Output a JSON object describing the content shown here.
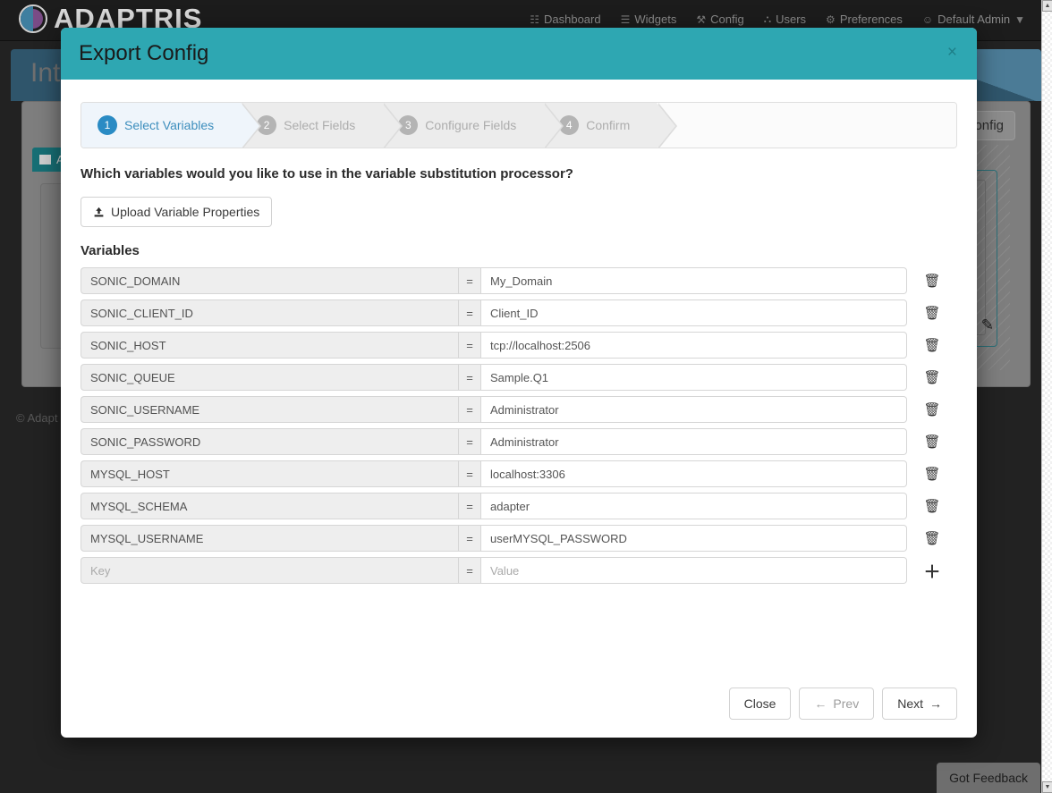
{
  "navbar": {
    "brand": "ADAPTRIS",
    "links": [
      {
        "label": "Dashboard",
        "icon": "dashboard-icon",
        "glyph": "☷"
      },
      {
        "label": "Widgets",
        "icon": "widgets-icon",
        "glyph": "☰"
      },
      {
        "label": "Config",
        "icon": "wrench-icon",
        "glyph": "⚒"
      },
      {
        "label": "Users",
        "icon": "users-icon",
        "glyph": "⛬"
      },
      {
        "label": "Preferences",
        "icon": "gears-icon",
        "glyph": "⚙"
      },
      {
        "label": "Default Admin",
        "icon": "user-icon",
        "glyph": "☺",
        "caret": "▼"
      }
    ]
  },
  "background": {
    "page_title": "Inte",
    "config_button": "y config",
    "adapter_badge": "A",
    "copyright": "© Adapt",
    "panel_add_icon": "+",
    "panel_edit_icon": "✎",
    "feedback_tab": "Got Feedback"
  },
  "modal": {
    "title": "Export Config",
    "close_label": "×",
    "wizard": [
      {
        "number": "1",
        "label": "Select Variables",
        "active": true
      },
      {
        "number": "2",
        "label": "Select Fields",
        "active": false
      },
      {
        "number": "3",
        "label": "Configure Fields",
        "active": false
      },
      {
        "number": "4",
        "label": "Confirm",
        "active": false
      }
    ],
    "question": "Which variables would you like to use in the variable substitution processor?",
    "upload_button": "Upload Variable Properties",
    "upload_icon": "⬆",
    "section_label": "Variables",
    "equals_sign": "=",
    "delete_icon": "🗑",
    "add_icon": "＋",
    "key_placeholder": "Key",
    "value_placeholder": "Value",
    "variables": [
      {
        "key": "SONIC_DOMAIN",
        "value": "My_Domain"
      },
      {
        "key": "SONIC_CLIENT_ID",
        "value": "Client_ID"
      },
      {
        "key": "SONIC_HOST",
        "value": "tcp://localhost:2506"
      },
      {
        "key": "SONIC_QUEUE",
        "value": "Sample.Q1"
      },
      {
        "key": "SONIC_USERNAME",
        "value": "Administrator"
      },
      {
        "key": "SONIC_PASSWORD",
        "value": "Administrator"
      },
      {
        "key": "MYSQL_HOST",
        "value": "localhost:3306"
      },
      {
        "key": "MYSQL_SCHEMA",
        "value": "adapter"
      },
      {
        "key": "MYSQL_USERNAME",
        "value": "userMYSQL_PASSWORD"
      }
    ],
    "new_row": {
      "key": "",
      "value": ""
    },
    "footer": {
      "close": "Close",
      "prev": "Prev",
      "prev_icon": "←",
      "next": "Next",
      "next_icon": "→"
    }
  },
  "colors": {
    "modal_header_teal": "#2ea7b2",
    "active_step_blue": "#2a8bc4",
    "active_step_bg": "#eff5fb"
  }
}
